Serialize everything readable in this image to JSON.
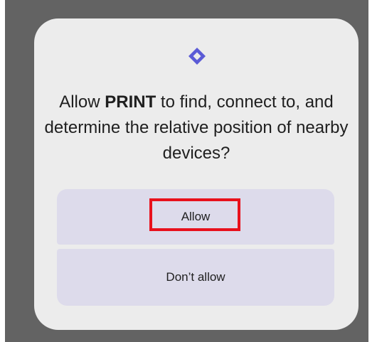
{
  "dialog": {
    "message_prefix": "Allow ",
    "app_name": "PRINT",
    "message_suffix": " to find, connect to, and determine the relative position of nearby devices?",
    "icon": "nearby-devices-icon",
    "accent_color": "#5b5bd6"
  },
  "buttons": {
    "allow_label": "Allow",
    "deny_label": "Don’t allow"
  },
  "colors": {
    "scrim": "#636363",
    "dialog_bg": "#ececec",
    "button_bg": "#dddbeb",
    "highlight": "#e8101c"
  }
}
